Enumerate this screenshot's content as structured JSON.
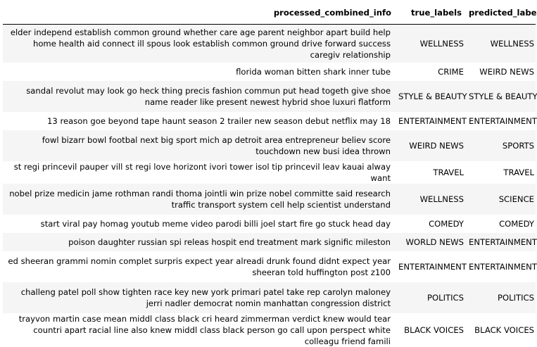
{
  "table": {
    "headers": [
      "processed_combined_info",
      "true_labels",
      "predicted_labels"
    ],
    "rows": [
      {
        "info": "elder independ establish common ground whether care age parent neighbor apart build help home health aid connect ill spous look establish common ground drive forward success caregiv relationship",
        "true_label": "WELLNESS",
        "predicted_label": "WELLNESS"
      },
      {
        "info": "florida woman bitten shark inner tube",
        "true_label": "CRIME",
        "predicted_label": "WEIRD NEWS"
      },
      {
        "info": "sandal revolut may look go heck thing precis fashion commun put head togeth give shoe name reader like present newest hybrid shoe luxuri flatform",
        "true_label": "STYLE & BEAUTY",
        "predicted_label": "STYLE & BEAUTY"
      },
      {
        "info": "13 reason goe beyond tape haunt season 2 trailer new season debut netflix may 18",
        "true_label": "ENTERTAINMENT",
        "predicted_label": "ENTERTAINMENT"
      },
      {
        "info": "fowl bizarr bowl footbal next big sport mich ap detroit area entrepreneur believ score touchdown new busi idea thrown",
        "true_label": "WEIRD NEWS",
        "predicted_label": "SPORTS"
      },
      {
        "info": "st regi princevil pauper vill st regi love horizont ivori tower isol tip princevil leav kauai alway want",
        "true_label": "TRAVEL",
        "predicted_label": "TRAVEL"
      },
      {
        "info": "nobel prize medicin jame rothman randi thoma jointli win prize nobel committe said research traffic transport system cell help scientist understand",
        "true_label": "WELLNESS",
        "predicted_label": "SCIENCE"
      },
      {
        "info": "start viral pay homag youtub meme video parodi billi joel start fire go stuck head day",
        "true_label": "COMEDY",
        "predicted_label": "COMEDY"
      },
      {
        "info": "poison daughter russian spi releas hospit end treatment mark signific mileston",
        "true_label": "WORLD NEWS",
        "predicted_label": "ENTERTAINMENT"
      },
      {
        "info": "ed sheeran grammi nomin complet surpris expect year alreadi drunk found didnt expect year sheeran told huffington post z100",
        "true_label": "ENTERTAINMENT",
        "predicted_label": "ENTERTAINMENT"
      },
      {
        "info": "challeng patel poll show tighten race key new york primari patel take rep carolyn maloney jerri nadler democrat nomin manhattan congression district",
        "true_label": "POLITICS",
        "predicted_label": "POLITICS"
      },
      {
        "info": "trayvon martin case mean middl class black cri heard zimmerman verdict knew would tear countri apart racial line also knew middl class black person go call upon perspect white colleagu friend famili",
        "true_label": "BLACK VOICES",
        "predicted_label": "BLACK VOICES"
      }
    ]
  }
}
